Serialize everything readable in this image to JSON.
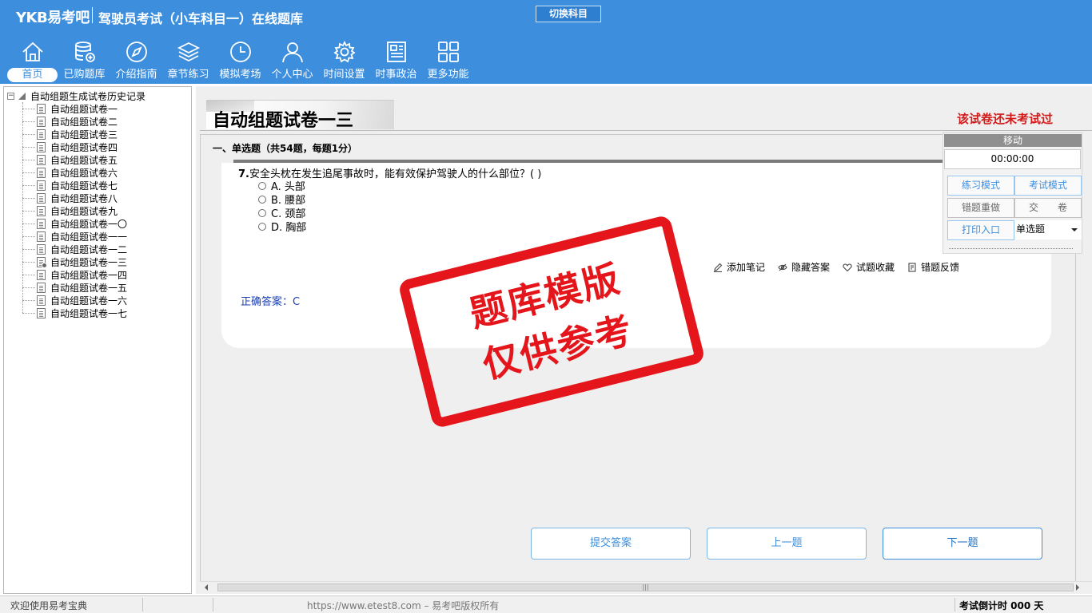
{
  "header": {
    "brand": "YKB易考吧",
    "app_title": "驾驶员考试（小车科目一）在线题库",
    "switch_label": "切换科目",
    "nav": [
      {
        "label": "首页",
        "icon": "home-icon"
      },
      {
        "label": "已购题库",
        "icon": "database-icon"
      },
      {
        "label": "介绍指南",
        "icon": "compass-icon"
      },
      {
        "label": "章节练习",
        "icon": "layers-icon"
      },
      {
        "label": "模拟考场",
        "icon": "clock-icon"
      },
      {
        "label": "个人中心",
        "icon": "user-icon"
      },
      {
        "label": "时间设置",
        "icon": "gear-icon"
      },
      {
        "label": "时事政治",
        "icon": "newspaper-icon"
      },
      {
        "label": "更多功能",
        "icon": "grid-icon"
      }
    ]
  },
  "tree": {
    "root": "自动组题生成试卷历史记录",
    "items": [
      "自动组题试卷一",
      "自动组题试卷二",
      "自动组题试卷三",
      "自动组题试卷四",
      "自动组题试卷五",
      "自动组题试卷六",
      "自动组题试卷七",
      "自动组题试卷八",
      "自动组题试卷九",
      "自动组题试卷一〇",
      "自动组题试卷一一",
      "自动组题试卷一二",
      "自动组题试卷一三",
      "自动组题试卷一四",
      "自动组题试卷一五",
      "自动组题试卷一六",
      "自动组题试卷一七"
    ],
    "current_index": 12
  },
  "paper": {
    "title": "自动组题试卷一三",
    "status": "该试卷还未考试过",
    "section": "一、单选题（共54题，每题1分）"
  },
  "question": {
    "number": "7.",
    "stem": "安全头枕在发生追尾事故时，能有效保护驾驶人的什么部位？( )",
    "options": [
      "A. 头部",
      "B. 腰部",
      "C. 颈部",
      "D. 胸部"
    ],
    "tools": [
      {
        "label": "添加笔记",
        "icon": "pencil-icon"
      },
      {
        "label": "隐藏答案",
        "icon": "eye-icon"
      },
      {
        "label": "试题收藏",
        "icon": "heart-icon"
      },
      {
        "label": "错题反馈",
        "icon": "feedback-icon"
      }
    ],
    "answer": "正确答案：C"
  },
  "control": {
    "move_label": "移动",
    "timer": "00:00:00",
    "practice_mode": "练习模式",
    "exam_mode": "考试模式",
    "redo_wrong": "错题重做",
    "submit_paper": "交　　卷",
    "print_entry": "打印入口",
    "type_select": "单选题"
  },
  "buttons": {
    "submit": "提交答案",
    "prev": "上一题",
    "next": "下一题"
  },
  "statusbar": {
    "welcome": "欢迎使用易考宝典",
    "copyright": "https://www.etest8.com – 易考吧版权所有",
    "countdown": "考试倒计时 000 天"
  },
  "watermark": {
    "line1": "题库模版",
    "line2": "仅供参考"
  }
}
